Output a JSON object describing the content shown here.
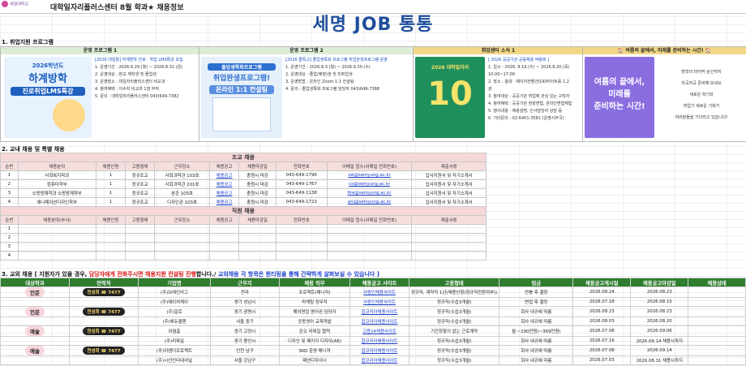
{
  "topbar": {
    "logo_text": "세명대학교",
    "centre_title": "대학일자리플러스센터  8월  학과★  채용정보"
  },
  "main_title": "세명  JOB  통통",
  "section1": {
    "title": "1. 취업지원 프로그램",
    "programs": [
      {
        "header": "운영 프로그램 1",
        "header_color": "#dcedd5",
        "poster": {
          "line1": "2026학년도",
          "line2": "하계방학",
          "line3": "진로취업LMS특강",
          "bg": "#e7f2ff",
          "accent": "#1e5fbf"
        },
        "lines": [
          "[2026 대일활] 하계방학 진로 · 취업 LMS특강 모집",
          "1. 운영기간 : 2026.6.29.(월) ~ 2026.8.31.(금)",
          "2. 운영대상 : 본교 재학생 및 졸업생",
          "3. 운영장소 : 대일자리플러스센터 비교과",
          "4. 참여혜택 : 이수자 비교과 1점 부여",
          "5. 문의 : 대학일자리플러스센터 043)649-7382"
        ]
      },
      {
        "header": "운영 프로그램 2",
        "header_color": "#dcedd5",
        "poster": {
          "line1": "졸업생특화프로그램",
          "line2": "취업완생프로그램!",
          "line3": "온라인 1:1 컨설팅",
          "bg": "#e6f0fb",
          "accent": "#2d6fd0"
        },
        "lines": [
          "[2026 졸특고] 졸업생특화 프로그램 취업완생프로그램 운영",
          "1. 운영기간 : 2026.8.3.(월) ~ 2026.9.30.(수)",
          "2. 운영대상 : 졸업(예정)생 및 미취업생",
          "3. 운영방법 : 온라인 Zoom 1:1 컨설팅",
          "4. 문의 : 졸업생특화 프로그램 담당자 043)649-7388"
        ]
      },
      {
        "header": "취업센터 소식 1",
        "header_color": "#f3d787",
        "poster": {
          "line1": "2026 대학일자리",
          "line2": "10",
          "line3": "",
          "bg": "#1f8f5b",
          "accent": "#f7e36b"
        },
        "lines": [
          "[ 2026 공공기관 공동채용 박람회 ]",
          "1. 일시 : 2026. 8.19.(수) ~ 2026.8.20.(목)",
          "   10:00~17:00",
          "2. 장소 : 충대 · 제이지컨벤션(DDP)아트홀 1,2",
          "   관",
          "3. 참여대상 : 공공기관 취업에 관심 있는 구직자",
          "4. 참여혜택 : 공공기관 현장면접, 온라인면접체험",
          "5. 행사내용 : 채용설명, 인사담당자 상담 등",
          "6. 기타문의 : 02-6401-3581 (운영사무국)"
        ]
      },
      {
        "header": "🏠 여름의 끝에서, 미래를 준비하는 시간! 🏠",
        "header_color": "#f3d787",
        "poster": {
          "line1": "여름의 끝에서,",
          "line2": "미래를",
          "line3": "준비하는 시간!",
          "bg": "#8a6ee0",
          "accent": "#ffffff"
        },
        "lines": [
          "방학의 마지막 순간까지",
          "차곡차곡 준비해 보세요",
          "새로운 학기와",
          "취업기 새로운 기회가",
          "여러분들을 기다리고 있습니다!"
        ]
      }
    ]
  },
  "section2": {
    "title": "2. 교내 채용 및 특별 채용",
    "table_title": "조교 채용",
    "columns": [
      "순번",
      "채용분야",
      "채용인원",
      "고용형태",
      "근무장소",
      "채용공고",
      "채용마감일",
      "전화번호",
      "이메일 접수(이메일 전화번호)",
      "제출서류"
    ],
    "rows": [
      [
        "1",
        "사회복지학과",
        "1",
        "정규조교",
        "사회과학관 103호",
        "채용공고",
        "충원시 마감",
        "043-649-1796",
        "sw@semyung.ac.kr",
        "입사지원서 및 자기소개서"
      ],
      [
        "2",
        "컴퓨터학부",
        "1",
        "정규조교",
        "사회과학관 201호",
        "채용공고",
        "충원시 마감",
        "043-649-1767",
        "cs@semyung.ac.kr",
        "입사지원서 및 자기소개서"
      ],
      [
        "3",
        "소방방재학과 소방방재학부",
        "1",
        "정규조교",
        "본관 105호",
        "채용공고",
        "충원시 마감",
        "043-649-1138",
        "fire@semyung.ac.kr",
        "입사지원서 및 자기소개서"
      ],
      [
        "4",
        "애니메이션디자인학부",
        "1",
        "정규조교",
        "디자인관 103호",
        "채용공고",
        "충원시 마감",
        "043-649-1723",
        "ani@semyung.ac.kr",
        "입사지원서 및 자기소개서"
      ]
    ],
    "table2_title": "직원 채용",
    "columns2": [
      "순번",
      "채용분야(부서)",
      "채용인원",
      "고용형태",
      "근무장소",
      "채용공고",
      "채용마감일",
      "전화번호",
      "이메일 접수(이메일 전화번호)",
      "제출서류"
    ],
    "rows2": [
      [
        "1"
      ],
      [
        "2"
      ],
      [
        "3"
      ],
      [
        "4"
      ]
    ]
  },
  "section3": {
    "title_a": "3. 교외 채용 [ 지원자가 있을 경우, ",
    "title_b": "담당자에게 전화주시면 채용지원 컨설팅 진행",
    "title_c": "합니다./  ",
    "title_d": "교외채용 각 항목은 원티링을 통해 간략하게 살펴보실 수 있습니다 ]",
    "columns": [
      "대상학과",
      "연락처",
      "기업명",
      "근무지",
      "채용 직무",
      "채용공고 사이트",
      "고용형태",
      "임금",
      "채용공고게시일",
      "채용공고마감일",
      "채용상태"
    ],
    "rows": [
      {
        "dept": "인문",
        "contact": "천성희 ☎ 7477",
        "company": "(주)브레인러그",
        "loc": "전라",
        "job": "프로젝트(매니저)",
        "site": "사람인채용사이트",
        "emp": "정규직, 계약직 1년(채용신청(정규직전환여부))",
        "pay": "연봉 후 결정",
        "post": "2026.08.24",
        "close": "2026.08.23",
        "status": ""
      },
      {
        "dept": "",
        "contact": "",
        "company": "(주)에이치케이",
        "loc": "경기 성남시",
        "job": "마케팅 정무직",
        "site": "사람인채용사이트",
        "emp": "정규직(수습3개월)",
        "pay": "면접 후 결정",
        "post": "2026.07.18",
        "close": "2026.08.15",
        "status": ""
      },
      {
        "dept": "인문",
        "contact": "천성희 ☎ 7477",
        "company": "(주)일로",
        "loc": "경기 광명시",
        "job": "해외영업 영어권 담당자",
        "site": "잡코리아채용사이트",
        "emp": "정규직(수습3개월)",
        "pay": "회사 내규에 따름",
        "post": "2026.08.23",
        "close": "2026.08.23",
        "status": ""
      },
      {
        "dept": "",
        "contact": "",
        "company": "(주)에듀콜렌",
        "loc": "서울 중구",
        "job": "공동영어 교재개발",
        "site": "잡코리아채용사이트",
        "emp": "정규직(수습3개월)",
        "pay": "회사 내규에 따름",
        "post": "2026.08.03",
        "close": "2026.08.20",
        "status": ""
      },
      {
        "dept": "예술",
        "contact": "천성희 ☎ 7477",
        "company": "이월홈",
        "loc": "경기 고양시",
        "job": "온오 리테일 협력",
        "site": "고용24채용사이트",
        "emp": "기간정함이 없는 근로계약",
        "pay": "월 ~290만원(~369만원)",
        "post": "2026.07.08",
        "close": "2026.09.06",
        "status": ""
      },
      {
        "dept": "",
        "contact": "",
        "company": "(주)리파일",
        "loc": "경기 용인시",
        "job": "디자인 및 패키지 디자이(AE)",
        "site": "잡코리아채용사이트",
        "emp": "정규직(수습3개월)",
        "pay": "회사 내규에 따름",
        "post": "2026.07.16",
        "close": "2026.09.14 채용시까지",
        "status": ""
      },
      {
        "dept": "예술",
        "contact": "천성희 ☎ 7477",
        "company": "(주)이엠디프로젝트",
        "loc": "인천 남구",
        "job": "SNS 운영 매니저",
        "site": "잡코리아채용사이트",
        "emp": "정규직(수습3개월)",
        "pay": "회사 내규에 따름",
        "post": "2026.07.08",
        "close": "2026.09.14",
        "status": ""
      },
      {
        "dept": "",
        "contact": "",
        "company": "(주)시선인터내셔널",
        "loc": "서울 강남구",
        "job": "패션디자이너",
        "site": "잡코리아채용사이트",
        "emp": "정규직(수습3개월)",
        "pay": "회사 내규에 따름",
        "post": "2026.07.03",
        "close": "2026.08.31 채용시까지",
        "status": ""
      }
    ]
  }
}
